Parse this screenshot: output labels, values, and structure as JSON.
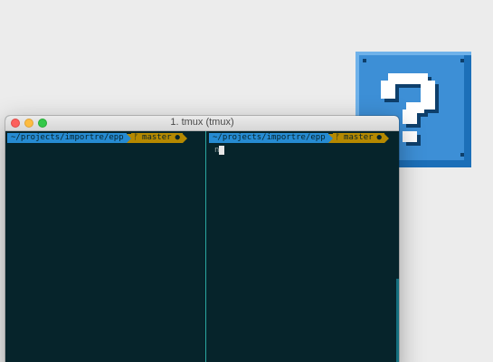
{
  "window": {
    "title": "1. tmux (tmux)"
  },
  "panes": {
    "left": {
      "path": "~/projects/importre/epp",
      "branch_icon": "branch-icon",
      "branch": "master",
      "status": "●"
    },
    "right": {
      "path": "~/projects/importre/epp",
      "branch_icon": "branch-icon",
      "branch": "master",
      "status": "●",
      "input": "n"
    }
  },
  "colors": {
    "terminal_bg": "#06242b",
    "path_segment": "#268bd2",
    "git_segment": "#b58900",
    "pane_divider": "#2aa7a0",
    "question_block_blue": "#3d8fd6",
    "question_block_dark": "#1c6fb8"
  },
  "icons": [
    "close-button",
    "minimize-button",
    "maximize-button",
    "branch-icon",
    "question-block-icon",
    "cursor"
  ]
}
